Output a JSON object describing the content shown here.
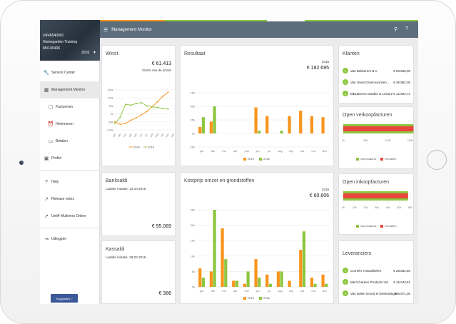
{
  "sidebar": {
    "user_code": "U4VA540001",
    "user_name": "Homegarden Training",
    "user_admin": "MVL00406",
    "year": "2016",
    "items": [
      {
        "label": "Service Center"
      },
      {
        "label": "Management Monitor"
      },
      {
        "label": "Factureren"
      },
      {
        "label": "Herinneren"
      },
      {
        "label": "Betalen"
      },
      {
        "label": "Profiel"
      },
      {
        "label": "Help"
      },
      {
        "label": "Release notes"
      },
      {
        "label": "Unit4 Multivers Online"
      },
      {
        "label": "Uitloggen"
      }
    ],
    "suggestion": "Suggesties ?"
  },
  "header": {
    "title": "Management Monitor",
    "filter_icon": "filter-icon",
    "help_icon": "help-icon"
  },
  "cards": {
    "winst": {
      "title": "Winst",
      "amount": "€ 61.413",
      "sub": "33,6% van de omzet"
    },
    "resultaat": {
      "title": "Resultaat",
      "year": "2016",
      "amount": "€ 182.695"
    },
    "klanten": {
      "title": "Klanten",
      "rows": [
        {
          "num": "1",
          "name": "Van Bekkerem B.V.",
          "amount": "€ 53.666,00"
        },
        {
          "num": "2",
          "name": "Van Onna Groenvoorzien...",
          "amount": "€ 36.952,00"
        },
        {
          "num": "3",
          "name": "MELBICKS Garden & Leisure",
          "amount": "€ 12.804,74"
        }
      ]
    },
    "verkoop": {
      "title": "Open verkoopfacturen",
      "legend_open": "Openstaand",
      "legend_overdue": "Vervallen"
    },
    "banksaldi": {
      "title": "Banksaldi",
      "mutatie": "Laatste mutatie: 13-10-2016",
      "amount": "€ 95.069"
    },
    "kostprijs": {
      "title": "Kostprijs omzet en grondstoffen",
      "year": "2016",
      "amount": "€ 60.606"
    },
    "inkoop": {
      "title": "Open inkoopfacturen",
      "legend_open": "Openstaand",
      "legend_overdue": "Vervallen"
    },
    "kassaldi": {
      "title": "Kassaldi",
      "mutatie": "Laatste mutatie: 28-02-2016",
      "amount": "€ 386"
    },
    "leveranciers": {
      "title": "Leveranciers",
      "rows": [
        {
          "num": "1",
          "name": "Cornel's Tuinartikelen",
          "amount": "€ 28.862,50"
        },
        {
          "num": "2",
          "name": "Merit Garden Products Ltd",
          "amount": "€ 16.043,61"
        },
        {
          "num": "3",
          "name": "Van Dalen Grond en bestratingen",
          "amount": "€ 6.971,00"
        }
      ]
    }
  },
  "colors": {
    "orange": "#f7941d",
    "green": "#8dc63f",
    "red": "#e8453c",
    "topbar": "#5c6d7c"
  },
  "chart_data": [
    {
      "id": "winst",
      "type": "line",
      "categories": [
        "jan",
        "feb",
        "mrt",
        "apr",
        "mei",
        "jun",
        "jul",
        "aug",
        "sep",
        "okt",
        "nov",
        "dec"
      ],
      "yticks": [
        "150k",
        "100k",
        "50k",
        "0k",
        "-50k",
        "-100k"
      ],
      "ylim": [
        -100,
        150
      ],
      "series": [
        {
          "name": "2016",
          "values": [
            -50,
            -65,
            -60,
            -40,
            -25,
            -5,
            15,
            45,
            75,
            110,
            135,
            null
          ]
        },
        {
          "name": "2018",
          "values": [
            -60,
            -20,
            60,
            55,
            65,
            70,
            50,
            45,
            40,
            35,
            30,
            null
          ]
        }
      ]
    },
    {
      "id": "resultaat",
      "type": "bar",
      "categories": [
        "jan",
        "feb",
        "mrt",
        "apr",
        "mei",
        "jun",
        "jul",
        "aug",
        "sep",
        "okt",
        "nov",
        "dec"
      ],
      "yticks": [
        "75k",
        "50k",
        "25k",
        "0k",
        "-25k"
      ],
      "ylim": [
        -25,
        75
      ],
      "series": [
        {
          "name": "2019",
          "values": [
            12,
            22,
            0,
            0,
            0,
            48,
            32,
            0,
            32,
            42,
            32,
            30
          ]
        },
        {
          "name": "2016",
          "values": [
            30,
            50,
            0,
            0,
            0,
            5,
            0,
            5,
            0,
            0,
            0,
            0
          ]
        }
      ]
    },
    {
      "id": "verkoop",
      "type": "bar",
      "xticks": [
        "0k",
        "50k",
        "100k",
        "150k"
      ],
      "series": [
        {
          "name": "Openstaand",
          "values": [
            157
          ]
        },
        {
          "name": "Vervallen",
          "values": [
            157
          ]
        }
      ]
    },
    {
      "id": "kostprijs",
      "type": "bar",
      "categories": [
        "jan",
        "feb",
        "mrt",
        "apr",
        "mei",
        "jun",
        "jul",
        "aug",
        "sep",
        "okt",
        "nov",
        "dec"
      ],
      "yticks": [
        "25k",
        "20k",
        "15k",
        "10k",
        "5k",
        "0k"
      ],
      "ylim": [
        0,
        25
      ],
      "series": [
        {
          "name": "2019",
          "values": [
            6,
            5,
            19,
            2,
            1,
            9,
            4,
            5,
            2,
            12,
            3,
            4
          ]
        },
        {
          "name": "2016",
          "values": [
            3,
            25,
            9,
            2,
            5,
            3,
            1,
            5,
            0,
            18,
            1,
            1
          ]
        }
      ]
    },
    {
      "id": "inkoop",
      "type": "bar",
      "xticks": [
        "0k",
        "10k",
        "20k",
        "30k",
        "40k",
        "50k",
        "60k"
      ],
      "series": [
        {
          "name": "Openstaand",
          "values": [
            58
          ]
        },
        {
          "name": "Vervallen",
          "values": [
            58
          ]
        }
      ]
    }
  ]
}
